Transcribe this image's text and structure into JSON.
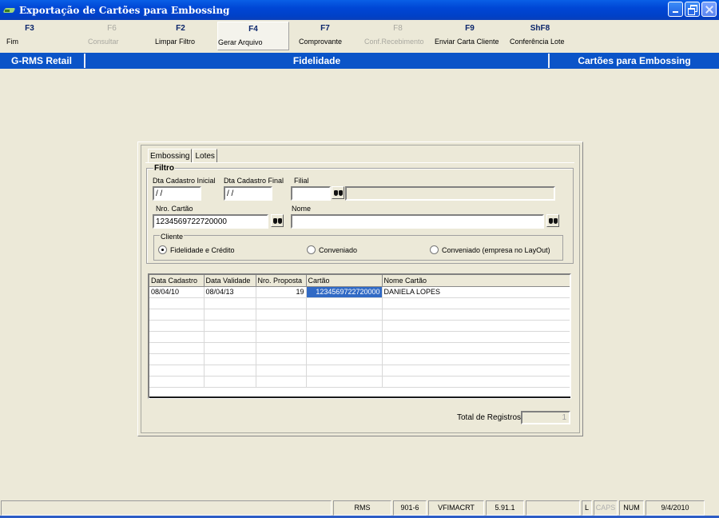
{
  "window": {
    "title": "Exportação de Cartões para Embossing"
  },
  "fkeys": [
    {
      "key": "F3",
      "label": "Fim",
      "enabled": true
    },
    {
      "key": "F6",
      "label": "Consultar",
      "enabled": false
    },
    {
      "key": "F2",
      "label": "Limpar Filtro",
      "enabled": true
    },
    {
      "key": "F4",
      "label": "Gerar Arquivo",
      "enabled": true
    },
    {
      "key": "F7",
      "label": "Comprovante",
      "enabled": true
    },
    {
      "key": "F8",
      "label": "Conf.Recebimento",
      "enabled": false
    },
    {
      "key": "F9",
      "label": "Enviar Carta Cliente",
      "enabled": true
    },
    {
      "key": "ShF8",
      "label": "Conferência Lote",
      "enabled": true
    }
  ],
  "header": {
    "left": "G-RMS Retail",
    "center": "Fidelidade",
    "right": "Cartões para Embossing"
  },
  "tabs": [
    "Embossing",
    "Lotes"
  ],
  "filtro": {
    "legend": "Filtro",
    "dta_inicial_label": "Dta Cadastro Inicial",
    "dta_inicial_value": " / /",
    "dta_final_label": "Dta Cadastro Final",
    "dta_final_value": " / /",
    "filial_label": "Filial",
    "filial_value": "",
    "filial_desc": "",
    "nro_cartao_label": "Nro. Cartão",
    "nro_cartao_value": "1234569722720000",
    "nome_label": "Nome",
    "nome_value": "",
    "cliente_legend": "Cliente",
    "radios": [
      {
        "label": "Fidelidade e Crédito",
        "checked": true
      },
      {
        "label": "Conveniado",
        "checked": false
      },
      {
        "label": "Conveniado (empresa no LayOut)",
        "checked": false
      }
    ]
  },
  "grid": {
    "columns": [
      "Data Cadastro",
      "Data Validade",
      "Nro. Proposta",
      "Cartão",
      "Nome Cartão"
    ],
    "rows": [
      [
        "08/04/10",
        "08/04/13",
        "19",
        "1234569722720000",
        "DANIELA LOPES"
      ]
    ]
  },
  "total": {
    "label": "Total de Registros:",
    "value": "1"
  },
  "status": {
    "system": "RMS",
    "code": "901-6",
    "program": "VFIMACRT",
    "version": "5.91.1",
    "l": "L",
    "caps": "CAPS",
    "num": "NUM",
    "date": "9/4/2010"
  }
}
